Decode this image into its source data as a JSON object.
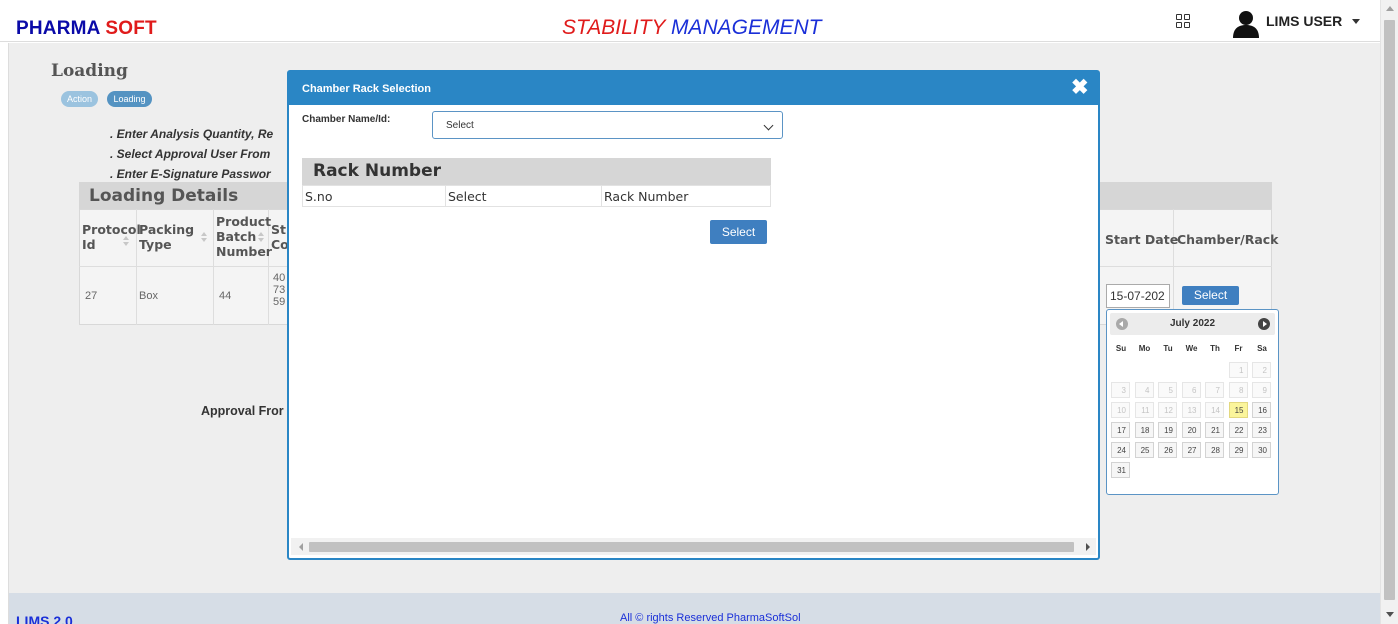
{
  "header": {
    "brand_main": "PHARMA",
    "brand_accent": "SOFT",
    "title_main": "STABILITY",
    "title_accent": "MANAGEMENT",
    "user_name": "LIMS USER"
  },
  "page": {
    "heading": "Loading",
    "breadcrumbs": [
      "Action",
      "Loading"
    ],
    "instructions": [
      ". Enter Analysis Quantity, Re",
      ". Select Approval User From",
      ". Enter E-Signature Passwor"
    ],
    "approval_label": "Approval Fror"
  },
  "loading_details": {
    "title": "Loading Details",
    "columns": {
      "protocol": [
        "Protocol",
        "Id"
      ],
      "packing": [
        "Packing",
        "Type"
      ],
      "batch": [
        "Product",
        "Batch",
        "Number"
      ],
      "stage": [
        "St",
        "Co"
      ],
      "start_date": "Start Date",
      "chamber_rack": "Chamber/Rack"
    },
    "row": {
      "protocol_id": "27",
      "packing_type": "Box",
      "batch_number": "44",
      "stage_lines": [
        "40",
        "73",
        "59"
      ],
      "start_date": "15-07-202",
      "select_label": "Select"
    }
  },
  "calendar": {
    "month_label": "July 2022",
    "dow": [
      "Su",
      "Mo",
      "Tu",
      "We",
      "Th",
      "Fr",
      "Sa"
    ],
    "first_weekday": 5,
    "days_in_month": 31,
    "today": 15,
    "enabled_from": 15,
    "highlight_color": "#fbf59b"
  },
  "modal": {
    "title": "Chamber Rack Selection",
    "close_glyph": "✖",
    "chamber_label": "Chamber Name/Id:",
    "chamber_value": "Select",
    "rack_title": "Rack Number",
    "rack_columns": [
      "S.no",
      "Select",
      "Rack Number"
    ],
    "select_button": "Select"
  },
  "footer": {
    "brand": "LIMS 2.0",
    "copyright": "All © rights Reserved PharmaSoftSol"
  },
  "colors": {
    "primary": "#2a86c5",
    "button": "#3f7fc0",
    "brand_blue": "#0a0aa8",
    "brand_red": "#e01b1b"
  }
}
